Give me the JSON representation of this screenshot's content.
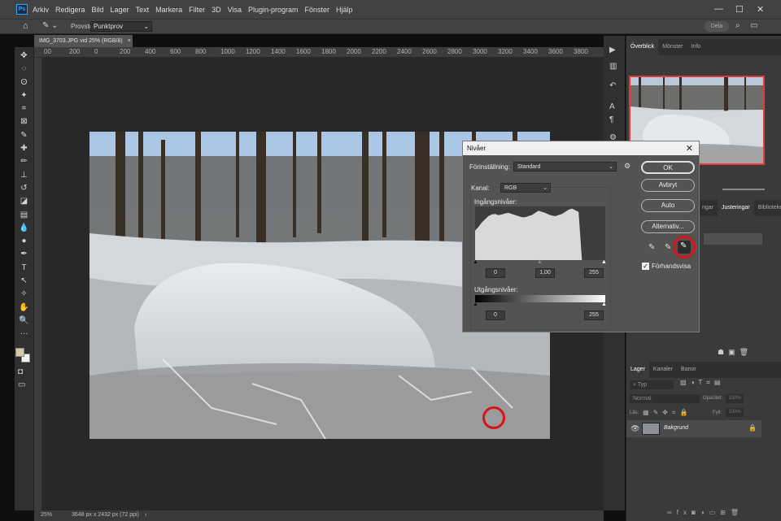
{
  "app": {
    "logo": "Ps",
    "menu": [
      "Arkiv",
      "Redigera",
      "Bild",
      "Lager",
      "Text",
      "Markera",
      "Filter",
      "3D",
      "Visa",
      "Plugin-program",
      "Fönster",
      "Hjälp"
    ],
    "window_controls": [
      "—",
      "☐",
      "✕"
    ]
  },
  "options_bar": {
    "sample_label": "Provstorlek:",
    "sample_value": "Punktprov",
    "share_label": "Dela"
  },
  "document": {
    "tab_title": "IMG_3703.JPG vid 25% (RGB/8)",
    "tab_close": "×"
  },
  "ruler_top_labels": [
    "00",
    "200",
    "0",
    "200",
    "400",
    "600",
    "800",
    "1000",
    "1200",
    "1400",
    "1600",
    "1800",
    "2000",
    "2200",
    "2400",
    "2600",
    "2800",
    "3000",
    "3200",
    "3400",
    "3600",
    "3800"
  ],
  "status": {
    "zoom": "25%",
    "size": "3648 px x 2432 px (72 ppi)",
    "arrow": "›"
  },
  "top_panel": {
    "tabs": [
      "Överblick",
      "Mönster",
      "Info"
    ]
  },
  "mid_panel": {
    "tabs": [
      "ngar",
      "Justeringar",
      "Biblioteket"
    ]
  },
  "layers_panel": {
    "tabs": [
      "Lager",
      "Kanaler",
      "Banor"
    ],
    "search_placeholder": "Typ",
    "blend_mode": "Normal",
    "opacity_label": "Opacitet:",
    "opacity_value": "100%",
    "lock_label": "Lås:",
    "fill_label": "Fyll:",
    "fill_value": "100%",
    "layers": [
      {
        "name": "Bakgrund",
        "visible": true,
        "locked": true
      }
    ]
  },
  "levels_dialog": {
    "title": "Nivåer",
    "preset_label": "Förinställning:",
    "preset_value": "Standard",
    "channel_label": "Kanal:",
    "channel_value": "RGB",
    "input_label": "Ingångsnivåer:",
    "input_black": "0",
    "input_gamma": "1,00",
    "input_white": "255",
    "output_label": "Utgångsnivåer:",
    "output_black": "0",
    "output_white": "255",
    "buttons": {
      "ok": "OK",
      "cancel": "Avbryt",
      "auto": "Auto",
      "options": "Alternativ..."
    },
    "preview_label": "Förhandsvisa",
    "preview_checked": true,
    "histogram": [
      0.55,
      0.62,
      0.7,
      0.76,
      0.82,
      0.85,
      0.86,
      0.84,
      0.85,
      0.87,
      0.88,
      0.86,
      0.84,
      0.82,
      0.8,
      0.8,
      0.82,
      0.84,
      0.88,
      0.92,
      0.9,
      0.88,
      0.85,
      0.83,
      0.82,
      0.84,
      0.86,
      0.9,
      0.94,
      0.96,
      0.93,
      0.9,
      0.0,
      0.0,
      0.0,
      0.0,
      0.0,
      0.0,
      0.0,
      0.0
    ]
  },
  "colors": {
    "accent_red": "#d81414",
    "foreground": "#d8c9a8",
    "background": "#f2f2f2"
  }
}
